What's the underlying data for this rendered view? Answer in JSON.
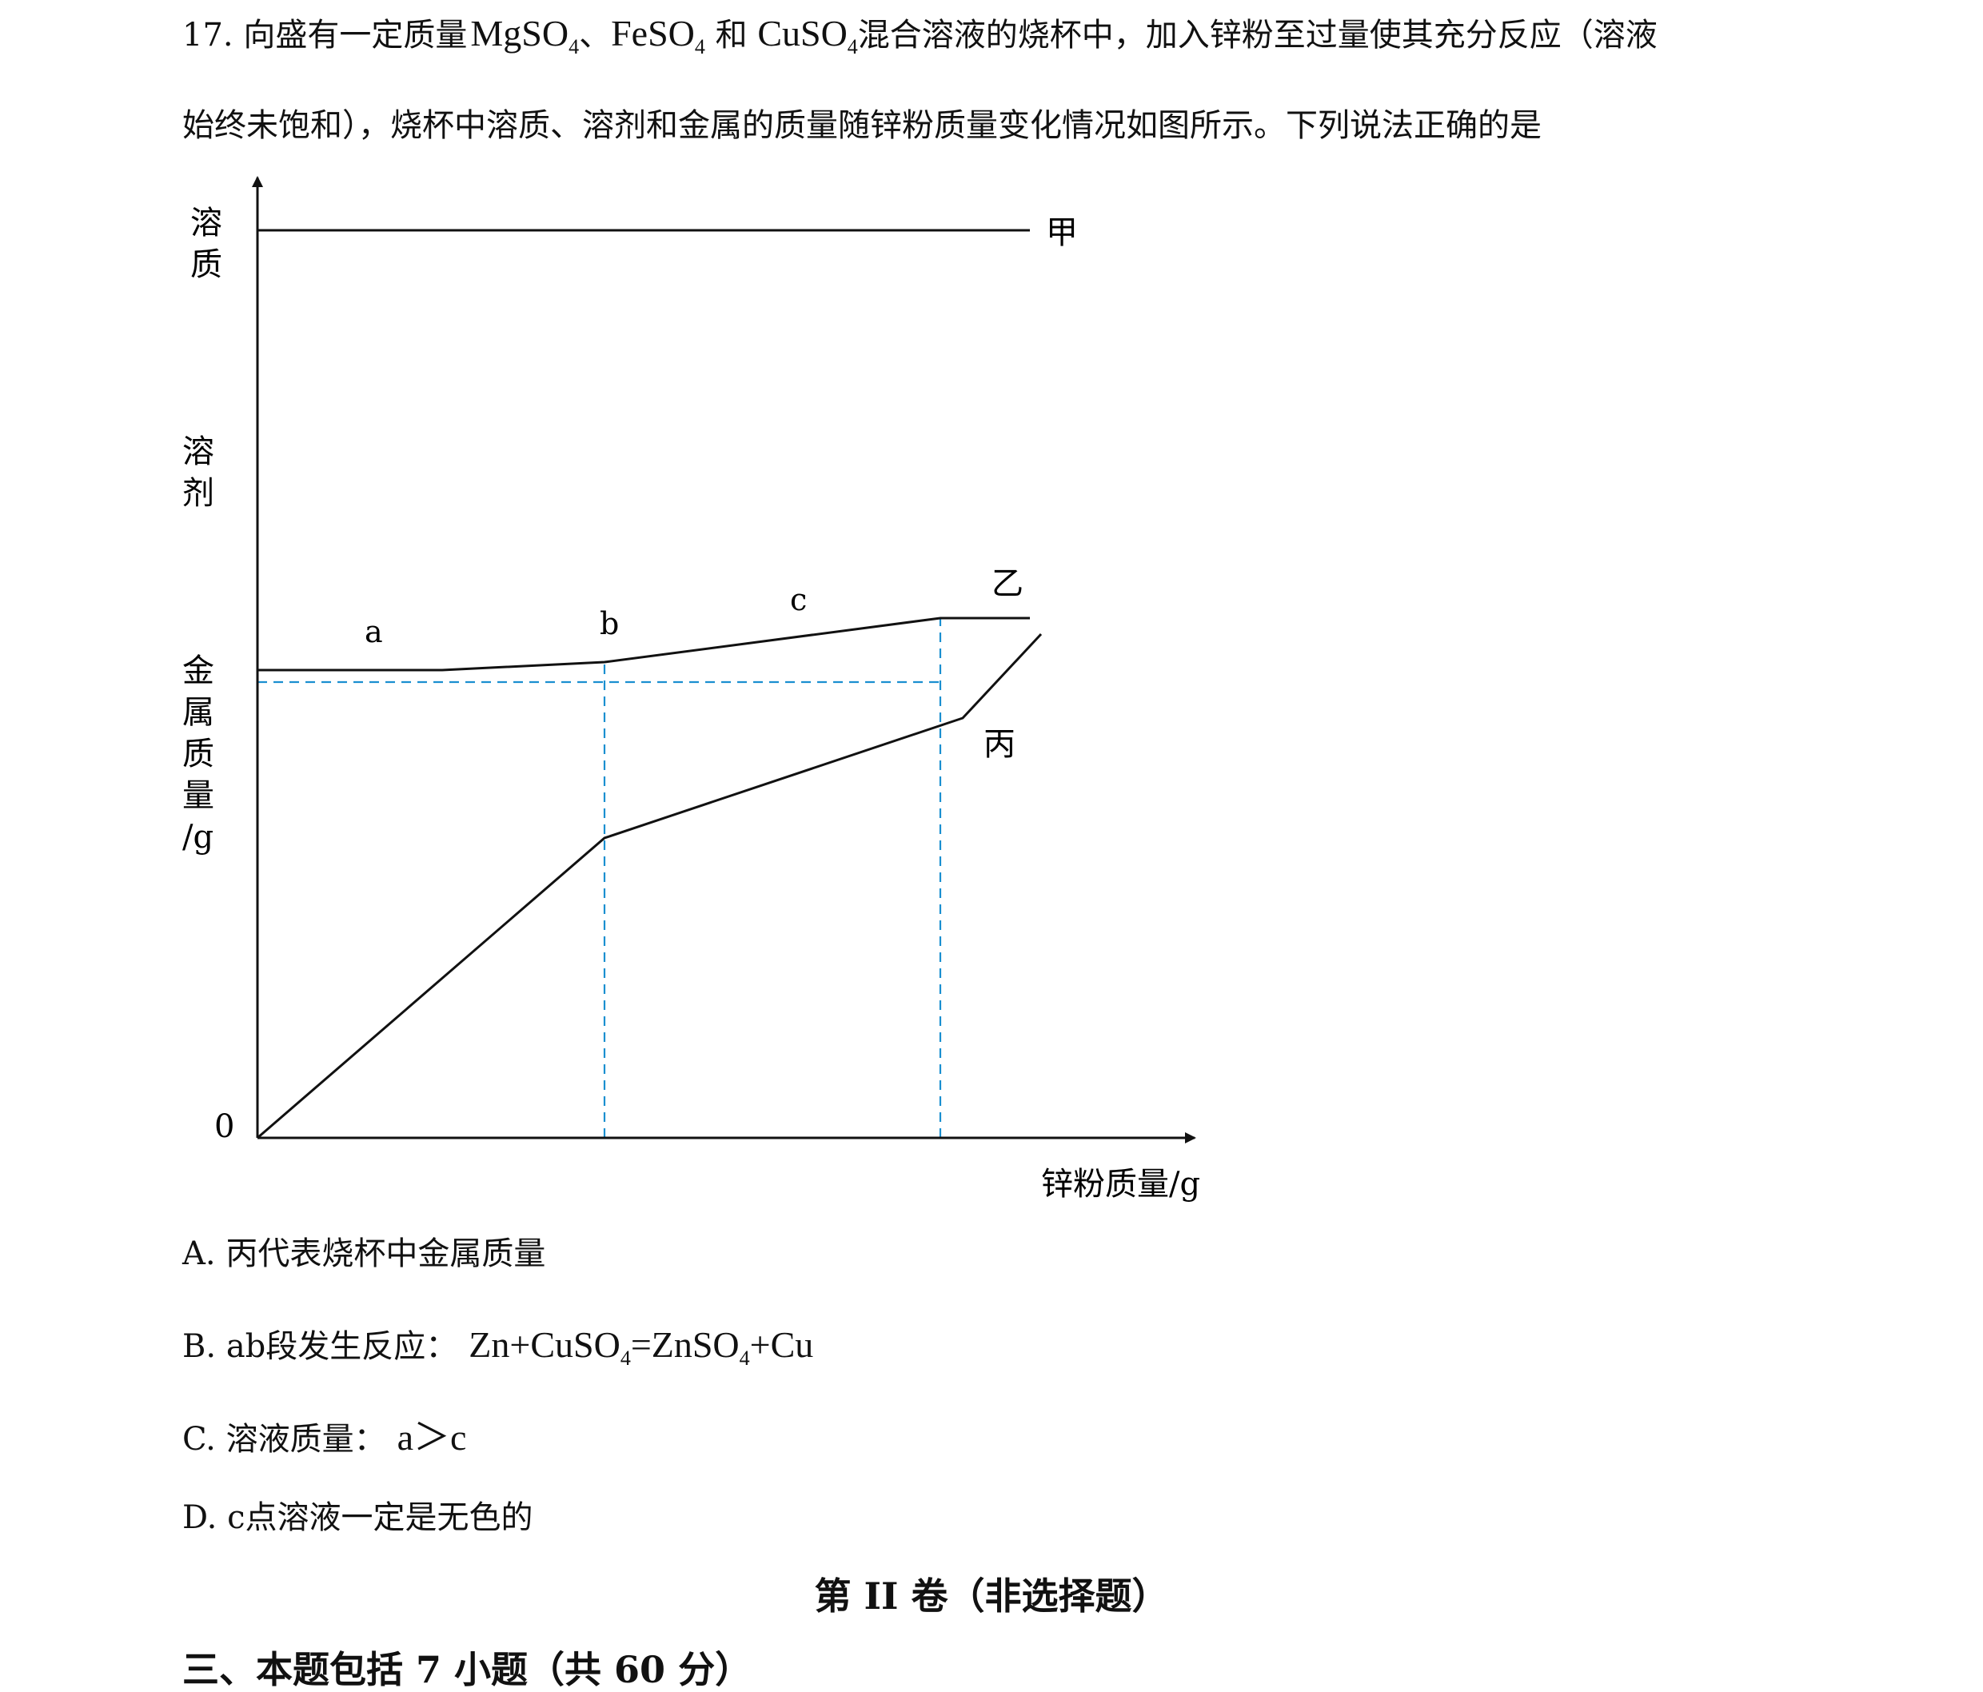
{
  "question": {
    "number": "17.",
    "line1_pre": "向盛有一定质量",
    "mg_formula": "MgSO",
    "sep1": "、",
    "fe_formula": "FeSO",
    "sep2": "和",
    "cu_formula": "CuSO",
    "subscript": "4",
    "line1_post": "混合溶液的烧杯中，加入锌粉至过量使其充分反应（溶液",
    "line2": "始终未饱和），烧杯中溶质、溶剂和金属的质量随锌粉质量变化情况如图所示。下列说法正确的是"
  },
  "chart_data": {
    "type": "line",
    "xlabel": "锌粉质量/g",
    "y_labels": [
      "溶质",
      "溶剂",
      "金属质量/g"
    ],
    "y_label_chars": {
      "solute": [
        "溶",
        "质"
      ],
      "solvent": [
        "溶",
        "剂"
      ],
      "metal": [
        "金",
        "属",
        "质",
        "量",
        "/g"
      ]
    },
    "origin_label": "0",
    "x_axis_max": 8.0,
    "y_axis_max": 12.0,
    "series": [
      {
        "name": "甲",
        "x": [
          0,
          6.9
        ],
        "y": [
          11.35,
          11.35
        ]
      },
      {
        "name": "乙",
        "x": [
          0,
          1.65,
          3.1,
          6.1,
          6.9
        ],
        "y": [
          5.85,
          5.85,
          5.95,
          6.5,
          6.5
        ]
      },
      {
        "name": "丙",
        "x": [
          0,
          3.1,
          6.3,
          7.0
        ],
        "y": [
          0,
          3.75,
          5.25,
          6.3
        ]
      }
    ],
    "point_labels": [
      {
        "text": "a",
        "x": 1.0,
        "y": 6.2
      },
      {
        "text": "b",
        "x": 3.1,
        "y": 6.3
      },
      {
        "text": "c",
        "x": 4.8,
        "y": 6.6
      }
    ],
    "guide_lines": {
      "vertical_x": [
        3.1,
        6.1
      ],
      "horizontal_y": 5.7,
      "color": "#1a8fd0"
    }
  },
  "options": {
    "A": {
      "label": "A.",
      "text": "丙代表烧杯中金属质量"
    },
    "B": {
      "label": "B. ab",
      "text": "段发生反应：",
      "f1": "Zn+CuSO",
      "f2": "=ZnSO",
      "f3": "+Cu",
      "sub": "4"
    },
    "C": {
      "label": "C.",
      "text": "溶液质量：",
      "compare": "a＞c"
    },
    "D": {
      "label": "D. c",
      "text": "点溶液一定是无色的"
    }
  },
  "section": {
    "title": "第 II 卷（非选择题）",
    "part": "三、本题包括 7 小题（共 60 分）"
  }
}
